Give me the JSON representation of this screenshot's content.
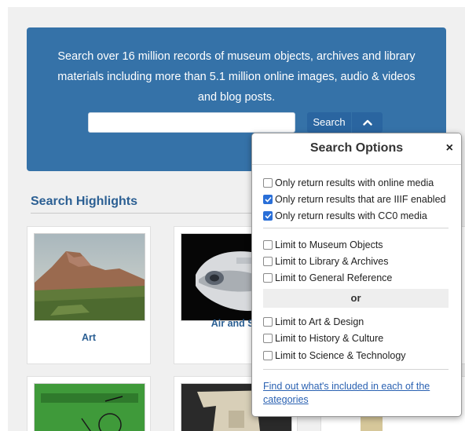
{
  "hero": {
    "line1": "Search over 16 million records of museum objects, archives and library",
    "line2": "materials including more than 5.1 million online images, audio & videos",
    "line3": "and blog posts.",
    "search_value": "",
    "search_button_label": "Search"
  },
  "highlights": {
    "title": "Search Highlights",
    "cards": [
      {
        "label": "Art"
      },
      {
        "label": "Air and Sp"
      }
    ]
  },
  "search_options": {
    "title": "Search Options",
    "close_label": "×",
    "options_group1": [
      {
        "label": "Only return results with online media",
        "checked": false
      },
      {
        "label": "Only return results that are IIIF enabled",
        "checked": true
      },
      {
        "label": "Only return results with CC0 media",
        "checked": true
      }
    ],
    "options_group2": [
      {
        "label": "Limit to Museum Objects",
        "checked": false
      },
      {
        "label": "Limit to Library & Archives",
        "checked": false
      },
      {
        "label": "Limit to General Reference",
        "checked": false
      }
    ],
    "or_label": "or",
    "options_group3": [
      {
        "label": "Limit to Art & Design",
        "checked": false
      },
      {
        "label": "Limit to History & Culture",
        "checked": false
      },
      {
        "label": "Limit to Science & Technology",
        "checked": false
      }
    ],
    "link_line1": "Find out what's included in each of the",
    "link_line2": "categories"
  },
  "colors": {
    "hero_bg": "#3572a8",
    "accent": "#2b5f93",
    "checkbox_checked": "#2a6fd8"
  }
}
